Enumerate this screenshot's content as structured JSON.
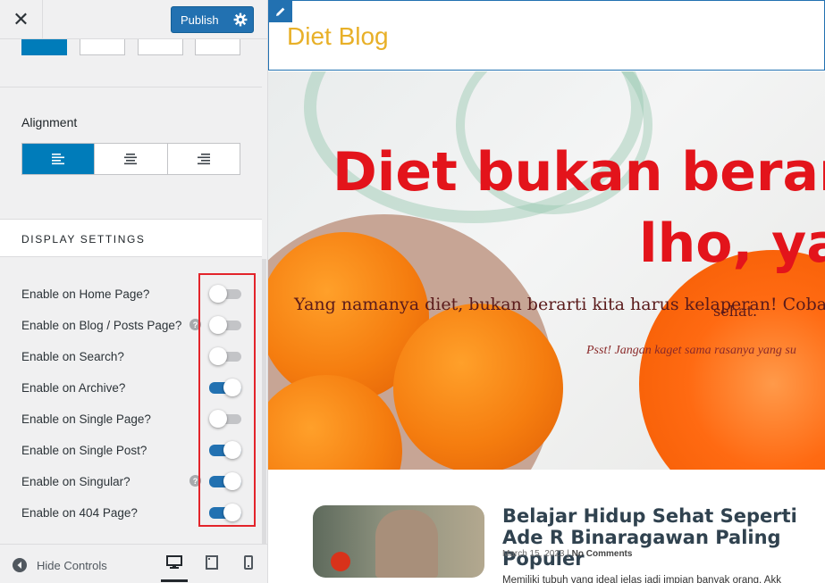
{
  "topbar": {
    "close_symbol": "✕",
    "publish_label": "Publish"
  },
  "alignment": {
    "label": "Alignment",
    "options": [
      "align-left",
      "align-center",
      "align-right"
    ],
    "selected": "align-left"
  },
  "display_settings": {
    "title": "DISPLAY SETTINGS",
    "toggles": [
      {
        "label": "Enable on Home Page?",
        "on": false,
        "help": false
      },
      {
        "label": "Enable on Blog / Posts Page?",
        "on": false,
        "help": true
      },
      {
        "label": "Enable on Search?",
        "on": false,
        "help": false
      },
      {
        "label": "Enable on Archive?",
        "on": true,
        "help": false
      },
      {
        "label": "Enable on Single Page?",
        "on": false,
        "help": false
      },
      {
        "label": "Enable on Single Post?",
        "on": true,
        "help": false
      },
      {
        "label": "Enable on Singular?",
        "on": true,
        "help": true
      },
      {
        "label": "Enable on 404 Page?",
        "on": true,
        "help": false
      }
    ]
  },
  "footer": {
    "hide_controls_label": "Hide Controls",
    "devices": [
      "desktop",
      "tablet",
      "mobile"
    ],
    "active_device": "desktop"
  },
  "preview": {
    "site_title": "Diet Blog",
    "hero": {
      "title_line1": "Diet bukan berarti",
      "title_line2": "lho, ya!",
      "subtitle": "Yang namanya diet, bukan berarti kita harus kelaperan! Coba deh ce",
      "subtitle_line2": "sehat.",
      "note": "Psst! Jangan kaget sama rasanya yang su"
    },
    "post": {
      "title": "Belajar Hidup Sehat Seperti Ade R Binaragawan Paling Populer",
      "date": "March 15, 2023",
      "comments": "No Comments",
      "excerpt": "Memiliki tubuh yang ideal jelas jadi impian banyak orang. Akk"
    }
  },
  "colors": {
    "accent": "#2271b1",
    "active_button": "#007cba",
    "highlight": "#e3242b",
    "site_title": "#e8b028",
    "hero_title": "#e3141b"
  }
}
